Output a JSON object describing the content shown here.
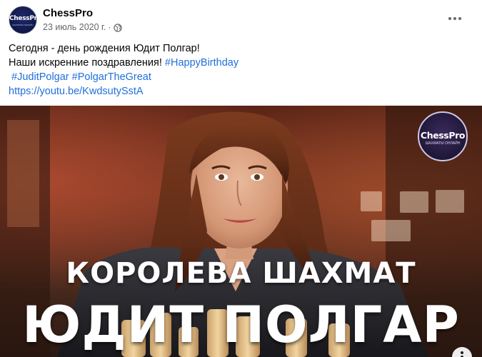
{
  "post": {
    "page_name": "ChessPro",
    "date": "23 июль 2020 г.",
    "separator": "·",
    "privacy_icon": "globe-icon",
    "more_icon": "more-horizontal-icon",
    "avatar_text": "ChessPro",
    "avatar_subtext": "ШАХМАТЫ ОНЛАЙН",
    "text_line1": "Сегодня - день рождения Юдит Полгар!",
    "text_line2_plain": "Наши искренние поздравления! ",
    "hashtag1": "#HappyBirthday",
    "hashtag2": "#JuditPolgar",
    "hashtag3": "#PolgarTheGreat",
    "url": "https://youtu.be/KwdsutySstA"
  },
  "image": {
    "badge_name": "ChessPro",
    "badge_tagline": "ШАХМАТЫ ОНЛАЙН",
    "caption_top": "КОРОЛЕВА ШАХМАТ",
    "caption_main": "ЮДИТ ПОЛГАР"
  },
  "colors": {
    "link": "#216fdb",
    "secondary_text": "#65676b",
    "primary_text": "#050505"
  }
}
